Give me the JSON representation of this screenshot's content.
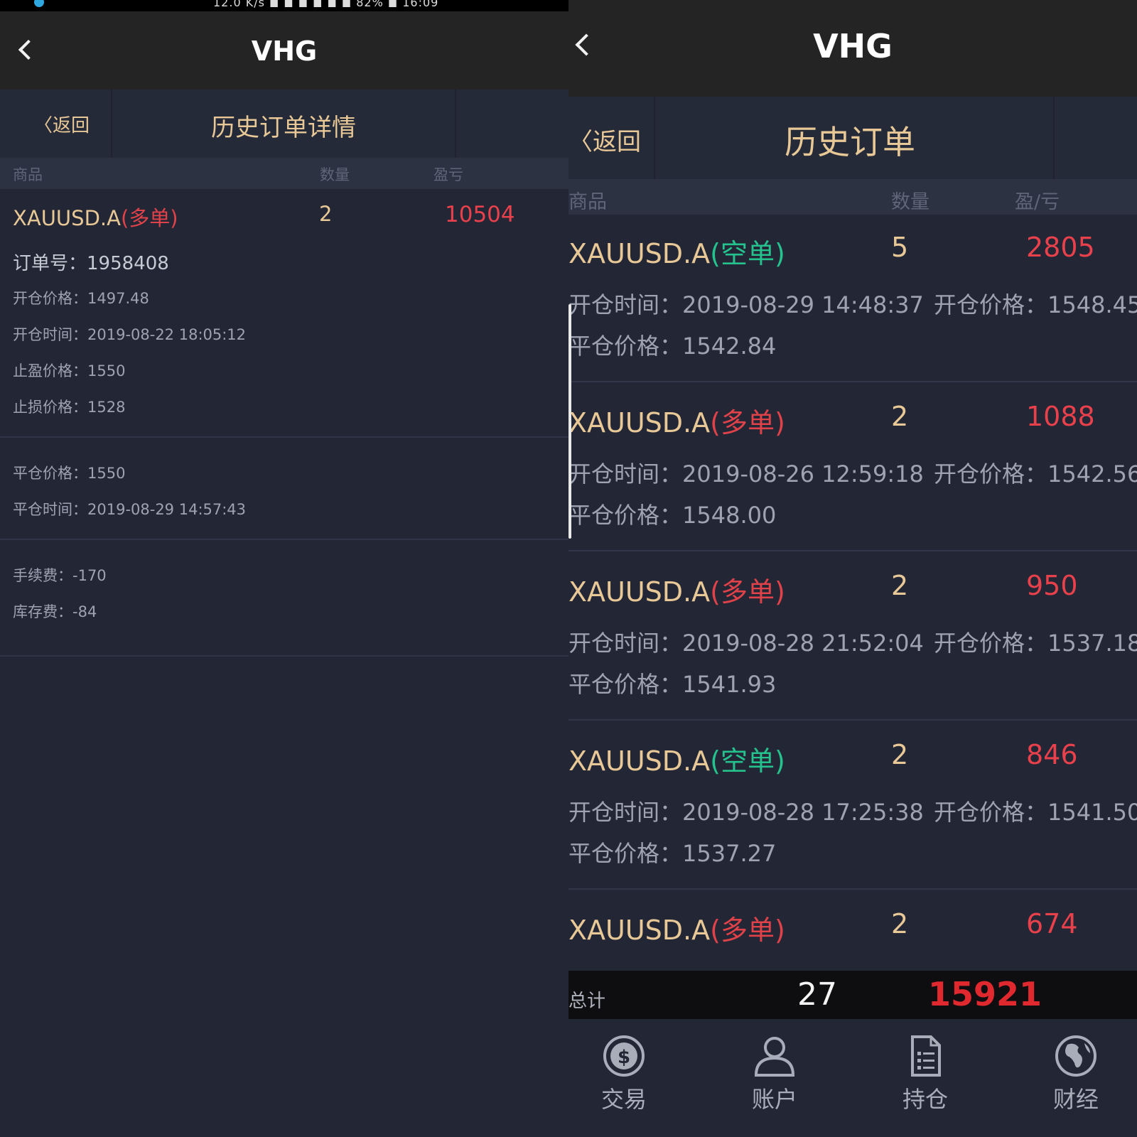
{
  "left": {
    "status_text": "12.0 K/s ◼ ◼ ◼ ◼ ◼ ◼ 82% ◼ 16:09",
    "app_title": "VHG",
    "back_label": "〈返回",
    "page_title": "历史订单详情",
    "columns": {
      "product": "商品",
      "quantity": "数量",
      "pnl": "盈亏"
    },
    "order": {
      "symbol": "XAUUSD.A",
      "direction": "(多单)",
      "quantity": "2",
      "pnl": "10504",
      "order_no": "订单号：1958408",
      "open_price": "开仓价格：1497.48",
      "open_time": "开仓时间：2019-08-22 18:05:12",
      "take_profit": "止盈价格：1550",
      "stop_loss": "止损价格：1528",
      "close_price": "平仓价格：1550",
      "close_time": "平仓时间：2019-08-29 14:57:43",
      "commission": "手续费：-170",
      "storage": "库存费：-84"
    }
  },
  "right": {
    "app_title": "VHG",
    "back_label": "〈返回",
    "page_title": "历史订单",
    "columns": {
      "product": "商品",
      "quantity": "数量",
      "pnl": "盈/亏"
    },
    "orders": [
      {
        "symbol": "XAUUSD.A",
        "direction": "(空单)",
        "side": "short",
        "quantity": "5",
        "pnl": "2805",
        "open_time": "开仓时间：2019-08-29 14:48:37",
        "open_price": "开仓价格：1548.45",
        "close_price": "平仓价格：1542.84"
      },
      {
        "symbol": "XAUUSD.A",
        "direction": "(多单)",
        "side": "long",
        "quantity": "2",
        "pnl": "1088",
        "open_time": "开仓时间：2019-08-26 12:59:18",
        "open_price": "开仓价格：1542.56",
        "close_price": "平仓价格：1548.00"
      },
      {
        "symbol": "XAUUSD.A",
        "direction": "(多单)",
        "side": "long",
        "quantity": "2",
        "pnl": "950",
        "open_time": "开仓时间：2019-08-28 21:52:04",
        "open_price": "开仓价格：1537.18",
        "close_price": "平仓价格：1541.93"
      },
      {
        "symbol": "XAUUSD.A",
        "direction": "(空单)",
        "side": "short",
        "quantity": "2",
        "pnl": "846",
        "open_time": "开仓时间：2019-08-28 17:25:38",
        "open_price": "开仓价格：1541.50",
        "close_price": "平仓价格：1537.27"
      },
      {
        "symbol": "XAUUSD.A",
        "direction": "(多单)",
        "side": "long",
        "quantity": "2",
        "pnl": "674"
      }
    ],
    "total": {
      "label": "总计",
      "quantity": "27",
      "pnl": "15921"
    },
    "tabs": [
      {
        "label": "交易",
        "icon": "dollar-coin-icon"
      },
      {
        "label": "账户",
        "icon": "user-icon"
      },
      {
        "label": "持仓",
        "icon": "document-list-icon"
      },
      {
        "label": "财经",
        "icon": "globe-icon"
      }
    ]
  },
  "colors": {
    "gold": "#e8c896",
    "red": "#e8414c",
    "green": "#25c28e",
    "background": "#232635"
  }
}
